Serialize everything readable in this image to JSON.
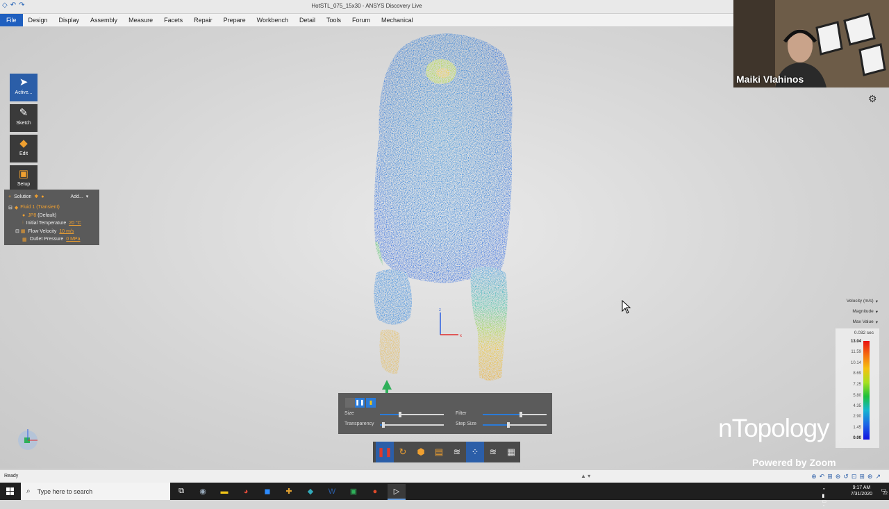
{
  "window": {
    "title": "HotSTL_075_15x30 - ANSYS Discovery Live"
  },
  "menu": {
    "items": [
      "File",
      "Design",
      "Display",
      "Assembly",
      "Measure",
      "Facets",
      "Repair",
      "Prepare",
      "Workbench",
      "Detail",
      "Tools",
      "Forum",
      "Mechanical"
    ]
  },
  "tools": [
    {
      "label": "Active...",
      "icon": "cursor-arrow-icon"
    },
    {
      "label": "Sketch",
      "icon": "pencil-icon"
    },
    {
      "label": "Edit",
      "icon": "edit-icon"
    },
    {
      "label": "Setup",
      "icon": "setup-icon"
    }
  ],
  "tree": {
    "header_label": "Solution",
    "add_label": "Add...",
    "fluid": "Fluid 1 (Transient)",
    "material": "JP8",
    "material_suffix": "(Default)",
    "rows": [
      {
        "label": "Initial Temperature",
        "value": "20 °C"
      },
      {
        "label": "Flow Velocity",
        "value": "10 m/s"
      },
      {
        "label": "Outlet Pressure",
        "value": "0 MPa"
      }
    ]
  },
  "webcam": {
    "name": "Maiki Vlahinos"
  },
  "legend": {
    "quantity": "Velocity (m/s)",
    "component": "Magnitude",
    "mode": "Max Value",
    "time": "0.032 sec",
    "ticks": [
      "13.04",
      "11.59",
      "10.14",
      "8.69",
      "7.25",
      "5.80",
      "4.35",
      "2.90",
      "1.45",
      "0.00"
    ],
    "colors": {
      "max": "#e81010",
      "mid": "#1ec03a",
      "min": "#1010e0"
    }
  },
  "particle_panel": {
    "size_label": "Size",
    "filter_label": "Filter",
    "transparency_label": "Transparency",
    "step_label": "Step Size",
    "size_level": 0.32,
    "filter_level": 0.6,
    "transparency_level": 0.05,
    "step_level": 0.4
  },
  "bottom_toolbar": {
    "icons": [
      "pause-icon",
      "reset-icon",
      "box-icon",
      "note-icon",
      "streamlines-icon",
      "particles-icon",
      "flow-lines-icon",
      "surface-icon"
    ]
  },
  "branding": {
    "logo": "nTopology",
    "zoom": "Powered by Zoom"
  },
  "status": {
    "text": "Ready"
  },
  "taskbar": {
    "search_placeholder": "Type here to search",
    "time": "9:17 AM",
    "date": "7/31/2020",
    "notifications": "22",
    "accent": "#1f5fbf"
  }
}
